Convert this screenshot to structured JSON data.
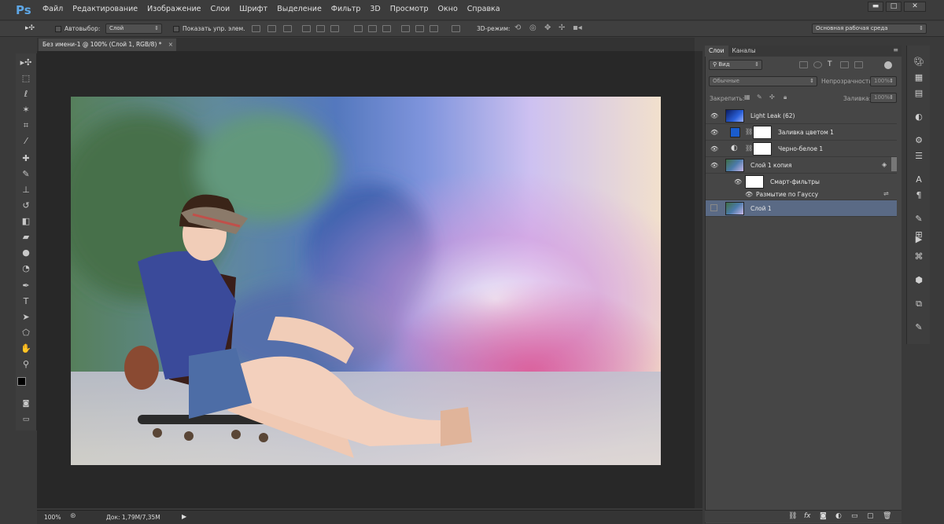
{
  "app": {
    "logo": "Ps"
  },
  "menu": [
    "Файл",
    "Редактирование",
    "Изображение",
    "Слои",
    "Шрифт",
    "Выделение",
    "Фильтр",
    "3D",
    "Просмотр",
    "Окно",
    "Справка"
  ],
  "window": {
    "minimize": "▬",
    "maximize": "□",
    "close": "✕"
  },
  "options": {
    "autoselect_label": "Автовыбор:",
    "autoselect_value": "Слой",
    "show_transform": "Показать упр. элем.",
    "mode3d": "3D-режим:",
    "workspace": "Основная рабочая среда"
  },
  "document": {
    "tab_title": "Без имени-1 @ 100% (Слой 1, RGB/8) *",
    "tab_close": "×",
    "zoom": "100%",
    "doc_info": "Док: 1,79M/7,35M"
  },
  "panel": {
    "tabs": [
      "Слои",
      "Каналы"
    ],
    "filter_kind": "Вид",
    "blend_mode": "Обычные",
    "opacity_label": "Непрозрачность:",
    "opacity_value": "100%",
    "lock_label": "Закрепить:",
    "fill_label": "Заливка:",
    "fill_value": "100%"
  },
  "layers": [
    {
      "name": "Light Leak (62)",
      "visible": true
    },
    {
      "name": "Заливка цветом 1",
      "visible": true
    },
    {
      "name": "Черно-белое 1",
      "visible": true
    },
    {
      "name": "Слой 1 копия",
      "visible": true
    },
    {
      "name": "Смарт-фильтры",
      "visible": true
    },
    {
      "name": "Размытие по Гауссу",
      "visible": true
    },
    {
      "name": "Слой 1",
      "visible": false,
      "selected": true
    }
  ],
  "colors": {
    "accent": "#5ea7e6",
    "selected_layer": "#5a6a85",
    "fill_swatch": "#1a5ccc"
  }
}
